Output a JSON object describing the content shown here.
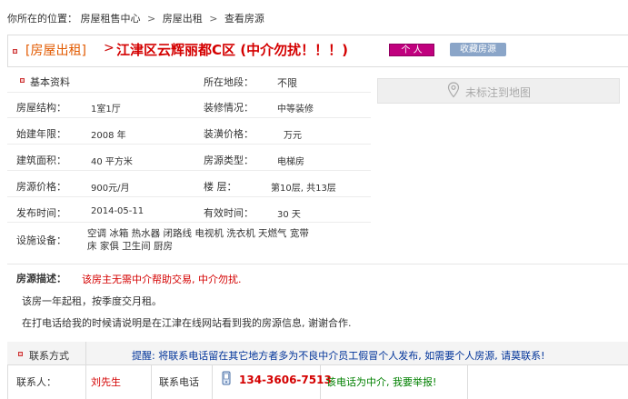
{
  "breadcrumb": {
    "prefix": "你所在的位置：",
    "items": [
      "房屋租售中心",
      "房屋出租",
      "查看房源"
    ],
    "sep": ">"
  },
  "title": {
    "category": "[房屋出租]",
    "arrow": ">",
    "text": "江津区云辉丽都C区 (中介勿扰！！！)",
    "badge_personal": "个  人",
    "badge_favorite": "收藏房源"
  },
  "details": {
    "section_label": "基本资料",
    "location_label": "所在地段：",
    "location_value": "不限",
    "structure_label": "房屋结构：",
    "structure_value": "1室1厅",
    "decoration_label": "装修情况：",
    "decoration_value": "中等装修",
    "year_label": "始建年限：",
    "year_value": "2008 年",
    "deco_price_label": "装潢价格：",
    "deco_price_value": "万元",
    "area_label": "建筑面积：",
    "area_value": "40 平方米",
    "type_label": "房源类型：",
    "type_value": "电梯房",
    "price_label": "房源价格：",
    "price_value": "900元/月",
    "floor_label": "楼  层：",
    "floor_value": "第10层, 共13层",
    "publish_label": "发布时间：",
    "publish_value": "2014-05-11",
    "valid_label": "有效时间：",
    "valid_value": "30 天",
    "facilities_label": "设施设备：",
    "facilities_line1": "空调 冰箱 热水器 闭路线 电视机 洗衣机 天燃气 宽带",
    "facilities_line2": "床 家俱 卫生间 厨房"
  },
  "map": {
    "label": "未标注到地图"
  },
  "description": {
    "head": "房源描述：",
    "warning": "该房主无需中介帮助交易, 中介勿扰.",
    "line1": "该房一年起租，按季度交月租。",
    "line2": "在打电话给我的时候请说明是在江津在线网站看到我的房源信息, 谢谢合作."
  },
  "contact": {
    "title": "联系方式",
    "notice": "提醒: 将联系电话留在其它地方者多为不良中介员工假冒个人发布, 如需要个人房源, 请莫联系!",
    "person_label": "联系人：",
    "person_value": "刘先生",
    "phone_label": "联系电话",
    "phone_value": "134-3606-7513",
    "phone_note": "该电话为中介, 我要举报!"
  },
  "colors": {
    "accent_red": "#d40000",
    "category_orange": "#e25a00",
    "badge_magenta": "#c0007e",
    "badge_blue": "#8aa5c8",
    "notice_blue": "#003399",
    "note_green": "#008000"
  },
  "icons": [
    "map-pin-icon",
    "phone-icon",
    "bullet-icon"
  ]
}
